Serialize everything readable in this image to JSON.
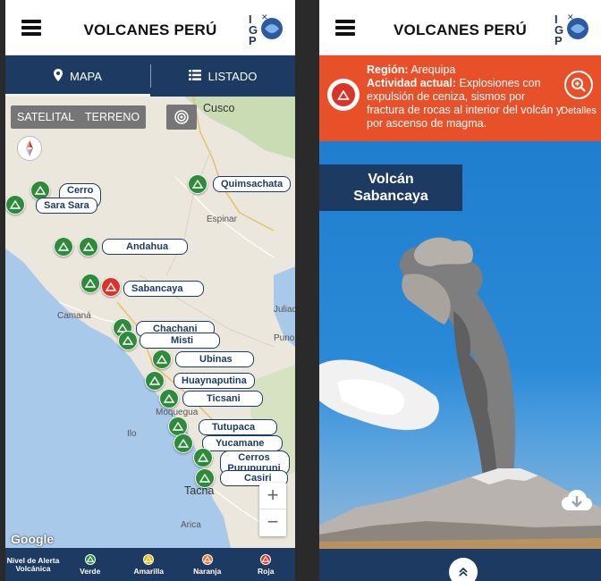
{
  "app": {
    "title": "VOLCANES PERÚ",
    "logo_letters": "IGP"
  },
  "tabs": [
    {
      "label": "MAPA",
      "icon": "location-pin-icon",
      "active": true
    },
    {
      "label": "LISTADO",
      "icon": "list-icon",
      "active": false
    }
  ],
  "map_controls": {
    "satellite": "SATELITAL",
    "terrain": "TERRENO",
    "zoom_in": "+",
    "zoom_out": "−",
    "attribution": "Google"
  },
  "towns": [
    "Cusco",
    "Espinar",
    "Juliaca",
    "Puno",
    "Camaná",
    "Moquegua",
    "Ilo",
    "Tacna",
    "Arica"
  ],
  "town_partial": {
    "juliaca": "Juliac",
    "arica": "Arica"
  },
  "volcanoes": [
    {
      "name": "Quimsachata",
      "level": "Verde"
    },
    {
      "name": "Cerro Auquihuato",
      "label_visible": "Cerro",
      "label_line2": "ato",
      "level": "Verde"
    },
    {
      "name": "Sara Sara",
      "level": "Verde"
    },
    {
      "name": "Andahua",
      "level": "Verde"
    },
    {
      "name": "Sabancaya",
      "level": "Roja"
    },
    {
      "name": "Chachani",
      "level": "Verde"
    },
    {
      "name": "Misti",
      "level": "Verde"
    },
    {
      "name": "Ubinas",
      "level": "Verde"
    },
    {
      "name": "Huaynaputina",
      "level": "Verde"
    },
    {
      "name": "Ticsani",
      "level": "Verde"
    },
    {
      "name": "Tutupaca",
      "level": "Verde"
    },
    {
      "name": "Yucamane",
      "level": "Verde"
    },
    {
      "name": "Cerros Purupuruni",
      "label_line1": "Cerros",
      "label_line2": "Purupuruni",
      "level": "Verde"
    },
    {
      "name": "Casiri",
      "level": "Verde"
    }
  ],
  "legend": {
    "title": "Nivel de Alerta Volcánica",
    "levels": [
      {
        "label": "Verde",
        "color": "#2e8b3a"
      },
      {
        "label": "Amarilla",
        "color": "#e8b400"
      },
      {
        "label": "Naranja",
        "color": "#e8702a"
      },
      {
        "label": "Roja",
        "color": "#d9332a"
      }
    ]
  },
  "detail": {
    "region_label": "Región:",
    "region_value": "Arequipa",
    "activity_label": "Actividad actual:",
    "activity_value": "Explosiones con expulsión de ceniza, sismos por fractura de rocas al interior del volcán y por ascenso de magma.",
    "details_button": "Detalles",
    "volcano_title_line1": "Volcán",
    "volcano_title_line2": "Sabancaya"
  },
  "colors": {
    "navy": "#1d3a63",
    "alert_orange": "#e8502a",
    "marker_green": "#2e8b3a",
    "marker_red": "#d9332a"
  }
}
